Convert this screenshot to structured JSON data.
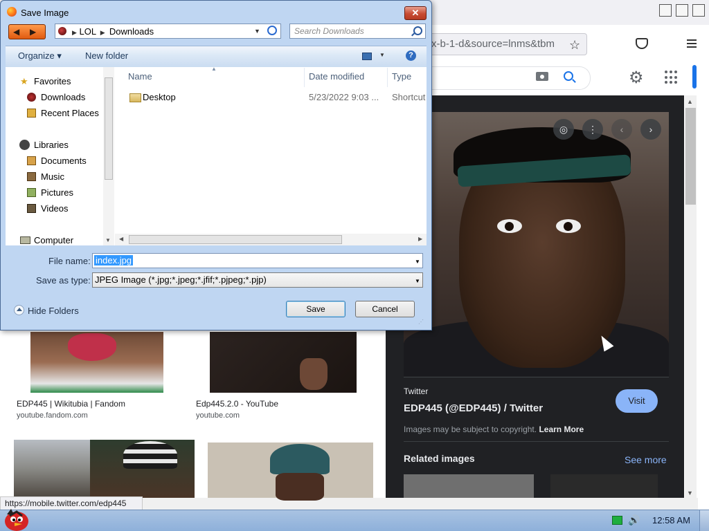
{
  "browser": {
    "url_fragment": "x-b-1-d&source=lnms&tbm",
    "status_link": "https://mobile.twitter.com/edp445"
  },
  "panel": {
    "source": "Twitter",
    "title": "EDP445 (@EDP445) / Twitter",
    "visit_label": "Visit",
    "copyright_text": "Images may be subject to copyright.",
    "learn_more": "Learn More",
    "related_title": "Related images",
    "see_more": "See more"
  },
  "results": [
    {
      "title": "EDP445 | Wikitubia | Fandom",
      "source": "youtube.fandom.com"
    },
    {
      "title": "Edp445.2.0 - YouTube",
      "source": "youtube.com"
    }
  ],
  "dialog": {
    "title": "Save Image",
    "close_glyph": "✕",
    "breadcrumb": [
      "LOL",
      "Downloads"
    ],
    "search_placeholder": "Search Downloads",
    "organize": "Organize ▾",
    "new_folder": "New folder",
    "help_glyph": "?",
    "nav": {
      "favorites": "Favorites",
      "downloads": "Downloads",
      "recent_places": "Recent Places",
      "libraries": "Libraries",
      "documents": "Documents",
      "music": "Music",
      "pictures": "Pictures",
      "videos": "Videos",
      "computer": "Computer"
    },
    "columns": {
      "name": "Name",
      "date_modified": "Date modified",
      "type": "Type"
    },
    "files": [
      {
        "name": "Desktop",
        "date": "5/23/2022 9:03 ...",
        "type": "Shortcut"
      }
    ],
    "file_name_label": "File name:",
    "file_name_value": "index.jpg",
    "save_type_label": "Save as type:",
    "save_type_value": "JPEG Image (*.jpg;*.jpeg;*.jfif;*.pjpeg;*.pjp)",
    "hide_folders": "Hide Folders",
    "save_label": "Save",
    "cancel_label": "Cancel"
  },
  "taskbar": {
    "time": "12:58 AM"
  },
  "colors": {
    "accent_blue": "#8ab4f8",
    "dialog_bg": "#bfd6f2",
    "selection": "#3399ff"
  }
}
